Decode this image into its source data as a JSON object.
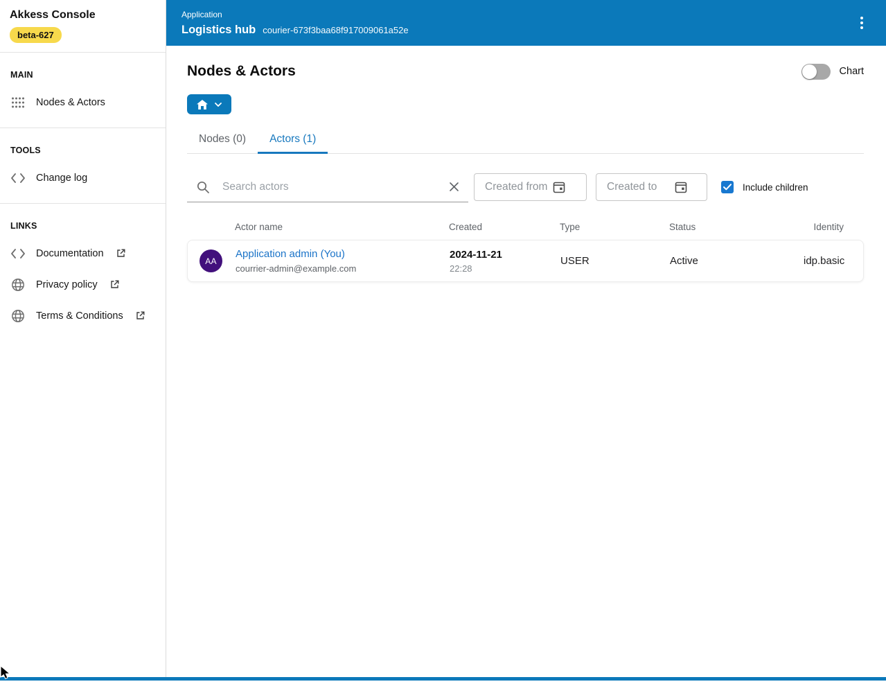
{
  "app": {
    "title": "Akkess Console",
    "badge": "beta-627"
  },
  "sidebar": {
    "sections": [
      {
        "label": "MAIN",
        "items": [
          {
            "label": "Nodes & Actors",
            "icon": "grid-icon",
            "external": false
          }
        ]
      },
      {
        "label": "TOOLS",
        "items": [
          {
            "label": "Change log",
            "icon": "code-icon",
            "external": false
          }
        ]
      },
      {
        "label": "LINKS",
        "items": [
          {
            "label": "Documentation",
            "icon": "code-icon",
            "external": true
          },
          {
            "label": "Privacy policy",
            "icon": "globe-icon",
            "external": true
          },
          {
            "label": "Terms & Conditions",
            "icon": "globe-icon",
            "external": true
          }
        ]
      }
    ]
  },
  "header": {
    "kicker": "Application",
    "title": "Logistics hub",
    "subtitle": "courier-673f3baa68f917009061a52e"
  },
  "page": {
    "title": "Nodes & Actors",
    "chart_toggle_label": "Chart",
    "chart_toggle_on": false
  },
  "tabs": [
    {
      "label": "Nodes (0)",
      "active": false
    },
    {
      "label": "Actors (1)",
      "active": true
    }
  ],
  "filters": {
    "search_placeholder": "Search actors",
    "search_value": "",
    "created_from_placeholder": "Created from",
    "created_from_value": "",
    "created_to_placeholder": "Created to",
    "created_to_value": "",
    "include_children_label": "Include children",
    "include_children_checked": true
  },
  "table": {
    "columns": [
      "Actor name",
      "Created",
      "Type",
      "Status",
      "Identity"
    ],
    "rows": [
      {
        "avatar_initials": "AA",
        "name": "Application admin (You)",
        "email": "courrier-admin@example.com",
        "created_date": "2024-11-21",
        "created_time": "22:28",
        "type": "USER",
        "status": "Active",
        "identity": "idp.basic"
      }
    ]
  },
  "colors": {
    "header_blue": "#0b79ba",
    "accent_blue": "#1778be",
    "checkbox_blue": "#1878d0",
    "badge_yellow": "#f7d94c",
    "avatar_purple": "#42107c"
  }
}
